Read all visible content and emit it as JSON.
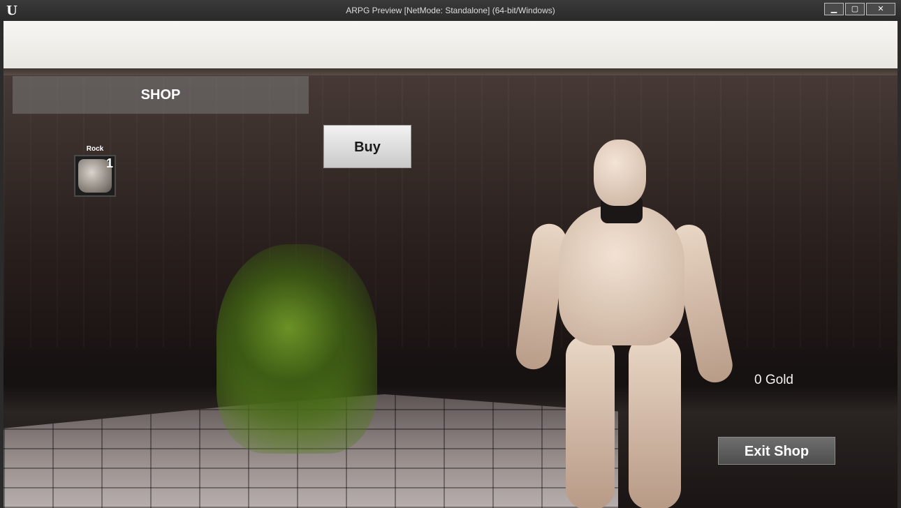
{
  "window": {
    "title": "ARPG Preview [NetMode: Standalone] (64-bit/Windows)",
    "logo_icon": "unreal-engine-logo",
    "controls": {
      "minimize_icon": "minimize-icon",
      "maximize_icon": "maximize-icon",
      "close_icon": "close-icon"
    }
  },
  "hud": {
    "shop_title": "SHOP",
    "buy_label": "Buy",
    "inventory": [
      {
        "name": "Rock",
        "quantity": "1",
        "icon": "rock-icon"
      }
    ],
    "gold_text": "0 Gold",
    "exit_label": "Exit Shop"
  }
}
